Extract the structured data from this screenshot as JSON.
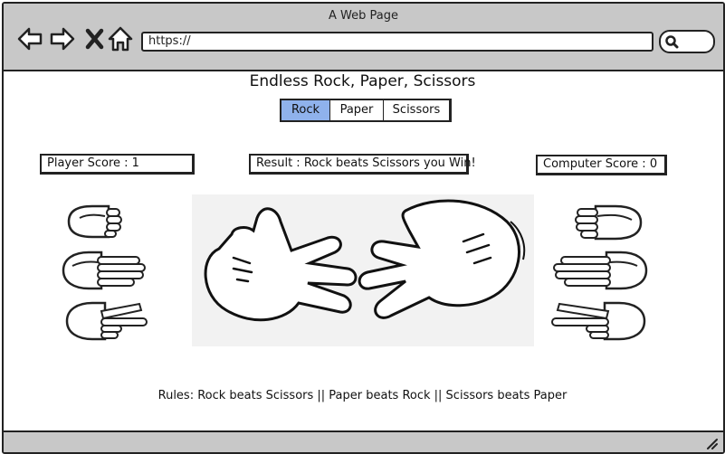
{
  "browser": {
    "title": "A Web Page",
    "url": "https://",
    "back_icon": "back-arrow-icon",
    "forward_icon": "forward-arrow-icon",
    "close_icon": "close-icon",
    "home_icon": "home-icon",
    "search_icon": "search-icon"
  },
  "game": {
    "heading": "Endless Rock, Paper, Scissors",
    "choices": [
      {
        "label": "Rock",
        "selected": true
      },
      {
        "label": "Paper",
        "selected": false
      },
      {
        "label": "Scissors",
        "selected": false
      }
    ],
    "player_score": "Player Score : 1",
    "result": "Result : Rock beats Scissors you Win!",
    "computer_score": "Computer Score : 0",
    "rules": "Rules: Rock beats Scissors || Paper beats Rock || Scissors beats Paper",
    "accent_color": "#8fb2ec"
  }
}
